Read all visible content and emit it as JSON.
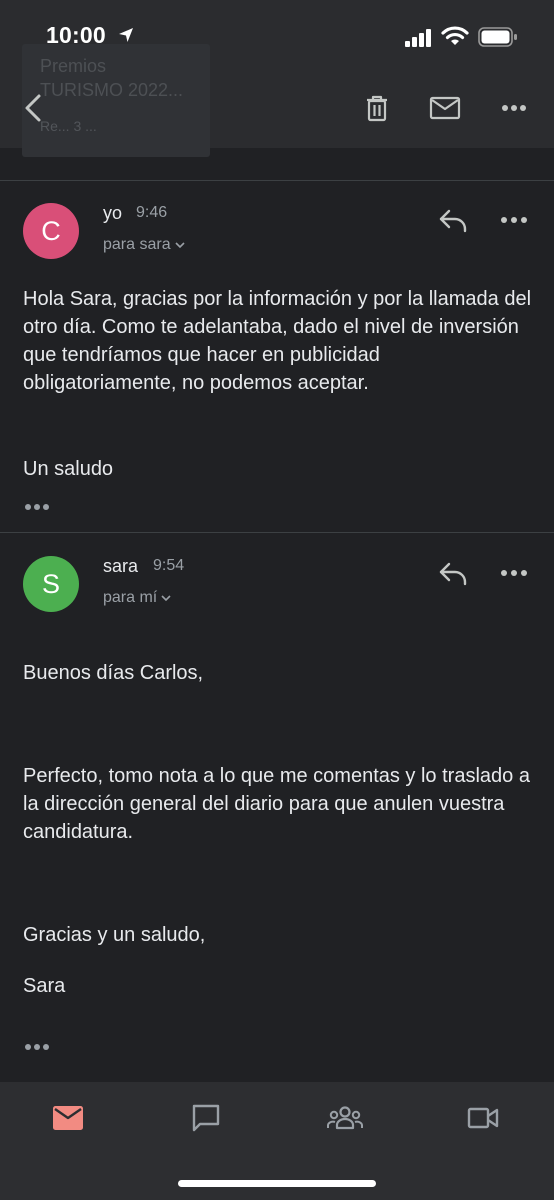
{
  "status": {
    "time": "10:00"
  },
  "header": {
    "subject_line1": "Premios",
    "subject_line2": "TURISMO 2022...",
    "chip_label": "Re... 3 ..."
  },
  "messages": [
    {
      "avatar_letter": "C",
      "avatar_color": "#d94f78",
      "sender": "yo",
      "time": "9:46",
      "recipient": "para sara",
      "body": [
        "Hola Sara, gracias por la información y por la llamada del otro día. Como te adelantaba, dado el nivel de inversión que tendríamos que hacer en publicidad obligatoriamente, no podemos aceptar.",
        "Un saludo"
      ]
    },
    {
      "avatar_letter": "S",
      "avatar_color": "#4caf50",
      "sender": "sara",
      "time": "9:54",
      "recipient": "para mí",
      "body": [
        "Buenos días Carlos,",
        "Perfecto, tomo nota a lo que me comentas y lo traslado a la dirección general del diario para que anulen vuestra candidatura.",
        "Gracias y un saludo,",
        "Sara"
      ]
    }
  ],
  "colors": {
    "background": "#202124",
    "accent_mail": "#f28b82",
    "icon_gray": "#9aa0a6"
  },
  "icons": {
    "back": "back-arrow-icon",
    "trash": "trash-icon",
    "mark_unread": "mail-icon",
    "more": "more-horizontal-icon",
    "reply": "reply-icon",
    "nav_mail": "mail-icon",
    "nav_chat": "chat-icon",
    "nav_spaces": "people-icon",
    "nav_meet": "video-camera-icon"
  }
}
